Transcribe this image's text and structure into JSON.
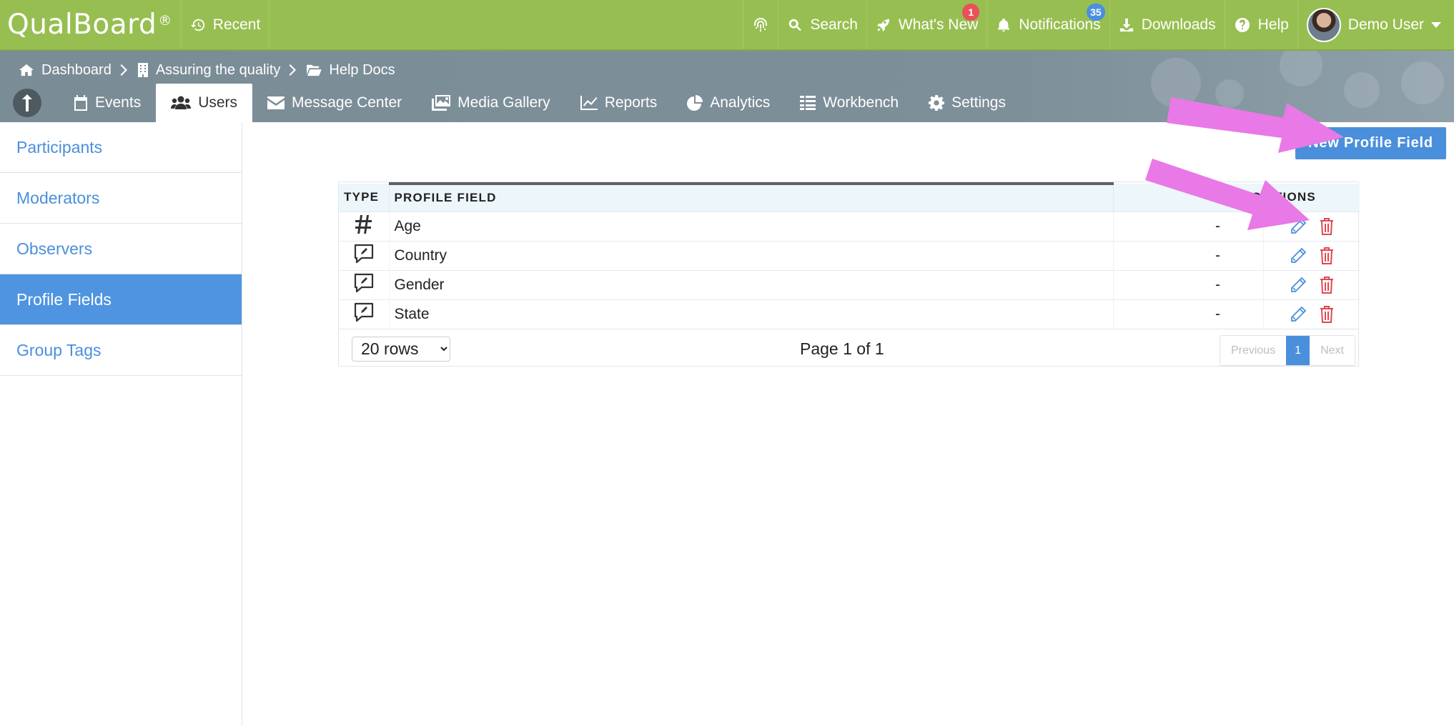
{
  "app": {
    "logo": "QualBoard",
    "logo_reg": "®"
  },
  "topbar": {
    "recent": "Recent",
    "search": "Search",
    "whats_new": "What's New",
    "whats_new_badge": "1",
    "notifications": "Notifications",
    "notifications_badge": "35",
    "downloads": "Downloads",
    "help": "Help",
    "user": "Demo User"
  },
  "breadcrumb": {
    "dashboard": "Dashboard",
    "project": "Assuring the quality",
    "folder": "Help Docs"
  },
  "tabs": {
    "events": "Events",
    "users": "Users",
    "message_center": "Message Center",
    "media_gallery": "Media Gallery",
    "reports": "Reports",
    "analytics": "Analytics",
    "workbench": "Workbench",
    "settings": "Settings"
  },
  "sidebar": {
    "items": [
      "Participants",
      "Moderators",
      "Observers",
      "Profile Fields",
      "Group Tags"
    ],
    "active": "Profile Fields"
  },
  "main": {
    "new_button": "New Profile Field",
    "columns": {
      "type": "TYPE",
      "field": "PROFILE FIELD",
      "participants": "PARTIC",
      "actions": "CTIONS"
    },
    "rows": [
      {
        "type_icon": "number-icon",
        "name": "Age",
        "participants": "-"
      },
      {
        "type_icon": "comment-edit-icon",
        "name": "Country",
        "participants": "-"
      },
      {
        "type_icon": "comment-edit-icon",
        "name": "Gender",
        "participants": "-"
      },
      {
        "type_icon": "comment-edit-icon",
        "name": "State",
        "participants": "-"
      }
    ],
    "rows_select": "20 rows",
    "page_info": "Page 1 of 1",
    "pagination": {
      "previous": "Previous",
      "current": "1",
      "next": "Next"
    }
  },
  "colors": {
    "topbar": "#97be51",
    "band": "#7d8f99",
    "accent": "#4a8fdc",
    "delete": "#e0484f",
    "annotation_arrow": "#e879e6"
  }
}
